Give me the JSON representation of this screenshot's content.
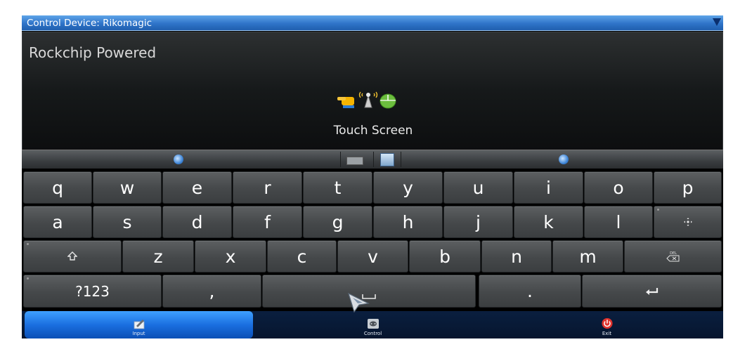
{
  "window": {
    "title": "Control Device: Rikomagic"
  },
  "display": {
    "brand": "Rockchip Powered",
    "mode_label": "Touch Screen",
    "mode_icons": [
      "hand-pointer-icon",
      "remote-antenna-icon",
      "mouse-icon"
    ]
  },
  "toolbar": {
    "icons": [
      "keyboard-icon",
      "globe-icon"
    ]
  },
  "keyboard": {
    "row1": [
      "q",
      "w",
      "e",
      "r",
      "t",
      "y",
      "u",
      "i",
      "o",
      "p"
    ],
    "row2": [
      "a",
      "s",
      "d",
      "f",
      "g",
      "h",
      "j",
      "k",
      "l"
    ],
    "row2_extra_icon": "move-cursor-icon",
    "row3": [
      "z",
      "x",
      "c",
      "v",
      "b",
      "n",
      "m"
    ],
    "row3_icons": [
      "shift-icon",
      "delete-icon"
    ],
    "row4": {
      "symbols_label": "?123",
      "comma": ",",
      "space_icon": "space-icon",
      "period": ".",
      "enter_icon": "enter-icon"
    }
  },
  "nav": {
    "items": [
      {
        "label": "Input",
        "icon": "pencil-paper-icon",
        "active": true
      },
      {
        "label": "Control",
        "icon": "gamepad-icon",
        "active": false
      },
      {
        "label": "Exit",
        "icon": "power-icon",
        "active": false
      }
    ]
  },
  "colors": {
    "accent": "#2f74c9",
    "nav_active": "#1a6fe0",
    "exit": "#e0322c"
  }
}
